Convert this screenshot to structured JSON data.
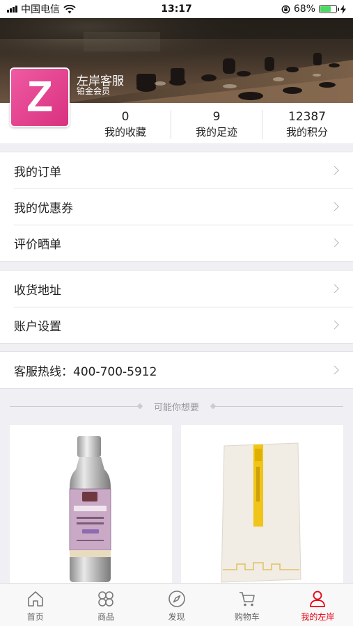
{
  "status_bar": {
    "carrier": "中国电信",
    "time": "13:17",
    "battery": "68%",
    "battery_level": 0.68
  },
  "profile": {
    "avatar_letter": "Z",
    "name": "左岸客服",
    "level": "铂金会员"
  },
  "stats": [
    {
      "value": "0",
      "label": "我的收藏"
    },
    {
      "value": "9",
      "label": "我的足迹"
    },
    {
      "value": "12387",
      "label": "我的积分"
    }
  ],
  "menu_group1": [
    {
      "label": "我的订单"
    },
    {
      "label": "我的优惠券"
    },
    {
      "label": "评价晒单"
    }
  ],
  "menu_group2": [
    {
      "label": "收货地址"
    },
    {
      "label": "账户设置"
    }
  ],
  "hotline": {
    "label": "客服热线：400-700-5912"
  },
  "recommend": {
    "title": "可能你想要"
  },
  "tabs": [
    {
      "label": "首页",
      "icon": "home-icon"
    },
    {
      "label": "商品",
      "icon": "grid-icon"
    },
    {
      "label": "发现",
      "icon": "compass-icon"
    },
    {
      "label": "购物车",
      "icon": "cart-icon"
    },
    {
      "label": "我的左岸",
      "icon": "user-icon"
    }
  ],
  "colors": {
    "accent": "#e60012",
    "avatar": "#e83e8c",
    "battery": "#4cd964"
  }
}
